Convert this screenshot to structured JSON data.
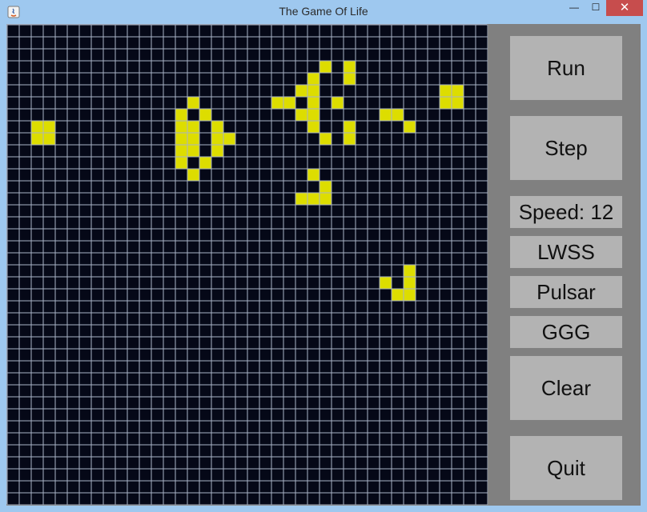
{
  "window": {
    "title": "The Game Of Life"
  },
  "controls": {
    "minimize": "—",
    "maximize": "☐",
    "close": "✕"
  },
  "board": {
    "cols": 40,
    "rows": 40,
    "grid_color": "#a9b3c7",
    "dead_color": "#050817",
    "live_color": "#dddd00",
    "live_cells": [
      [
        2,
        8
      ],
      [
        3,
        8
      ],
      [
        2,
        9
      ],
      [
        3,
        9
      ],
      [
        15,
        6
      ],
      [
        14,
        7
      ],
      [
        16,
        7
      ],
      [
        14,
        8
      ],
      [
        15,
        8
      ],
      [
        17,
        8
      ],
      [
        18,
        9
      ],
      [
        14,
        9
      ],
      [
        15,
        9
      ],
      [
        17,
        9
      ],
      [
        14,
        10
      ],
      [
        15,
        10
      ],
      [
        17,
        10
      ],
      [
        14,
        11
      ],
      [
        16,
        11
      ],
      [
        15,
        12
      ],
      [
        26,
        3
      ],
      [
        28,
        3
      ],
      [
        25,
        4
      ],
      [
        28,
        4
      ],
      [
        24,
        5
      ],
      [
        25,
        5
      ],
      [
        22,
        6
      ],
      [
        23,
        6
      ],
      [
        25,
        6
      ],
      [
        27,
        6
      ],
      [
        24,
        7
      ],
      [
        25,
        7
      ],
      [
        25,
        8
      ],
      [
        28,
        8
      ],
      [
        26,
        9
      ],
      [
        28,
        9
      ],
      [
        31,
        7
      ],
      [
        32,
        7
      ],
      [
        33,
        8
      ],
      [
        36,
        5
      ],
      [
        37,
        5
      ],
      [
        36,
        6
      ],
      [
        37,
        6
      ],
      [
        25,
        12
      ],
      [
        26,
        13
      ],
      [
        24,
        14
      ],
      [
        25,
        14
      ],
      [
        26,
        14
      ],
      [
        33,
        20
      ],
      [
        31,
        21
      ],
      [
        33,
        21
      ],
      [
        32,
        22
      ],
      [
        33,
        22
      ]
    ]
  },
  "panel": {
    "run": "Run",
    "step": "Step",
    "speed": "Speed: 12",
    "lwss": "LWSS",
    "pulsar": "Pulsar",
    "ggg": "GGG",
    "clear": "Clear",
    "quit": "Quit"
  }
}
